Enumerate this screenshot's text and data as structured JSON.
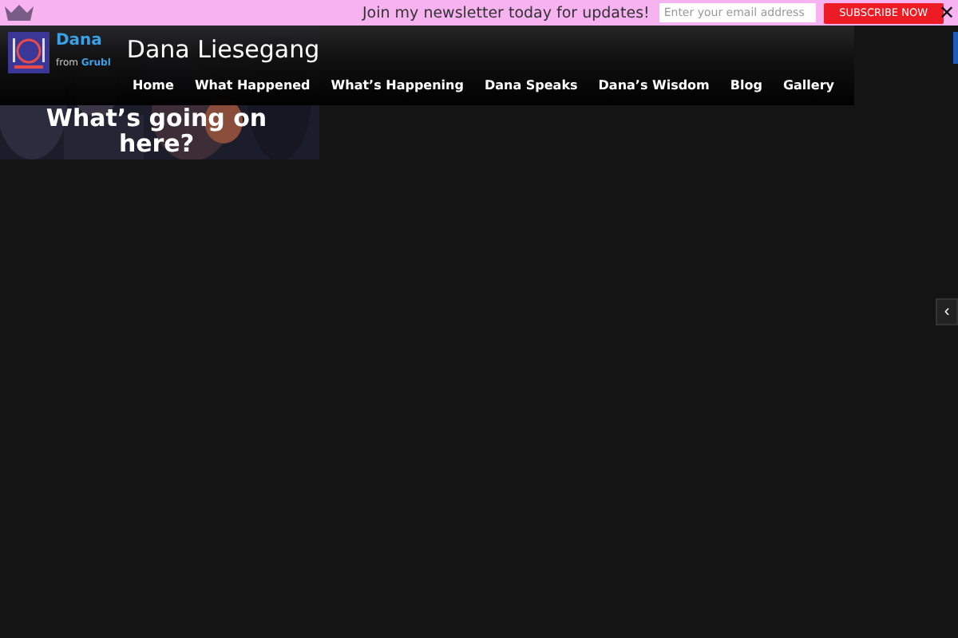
{
  "newsletter_bar": {
    "message": "Join my newsletter today for updates!",
    "email_placeholder": "Enter your email address",
    "subscribe_button": "SUBSCRIBE NOW",
    "close": "✕"
  },
  "logo": {
    "name": "Dana",
    "tagline_prefix": "from",
    "tagline_brand": "Grubl"
  },
  "site_title": "Dana Liesegang",
  "nav": [
    {
      "label": "Home"
    },
    {
      "label": "What Happened"
    },
    {
      "label": "What’s Happening"
    },
    {
      "label": "Dana Speaks"
    },
    {
      "label": "Dana’s Wisdom"
    },
    {
      "label": "Blog"
    },
    {
      "label": "Gallery"
    }
  ],
  "hero": {
    "kind": "picture",
    "heading": "What’s going on here?"
  },
  "side_tab": {
    "label": "‹"
  }
}
